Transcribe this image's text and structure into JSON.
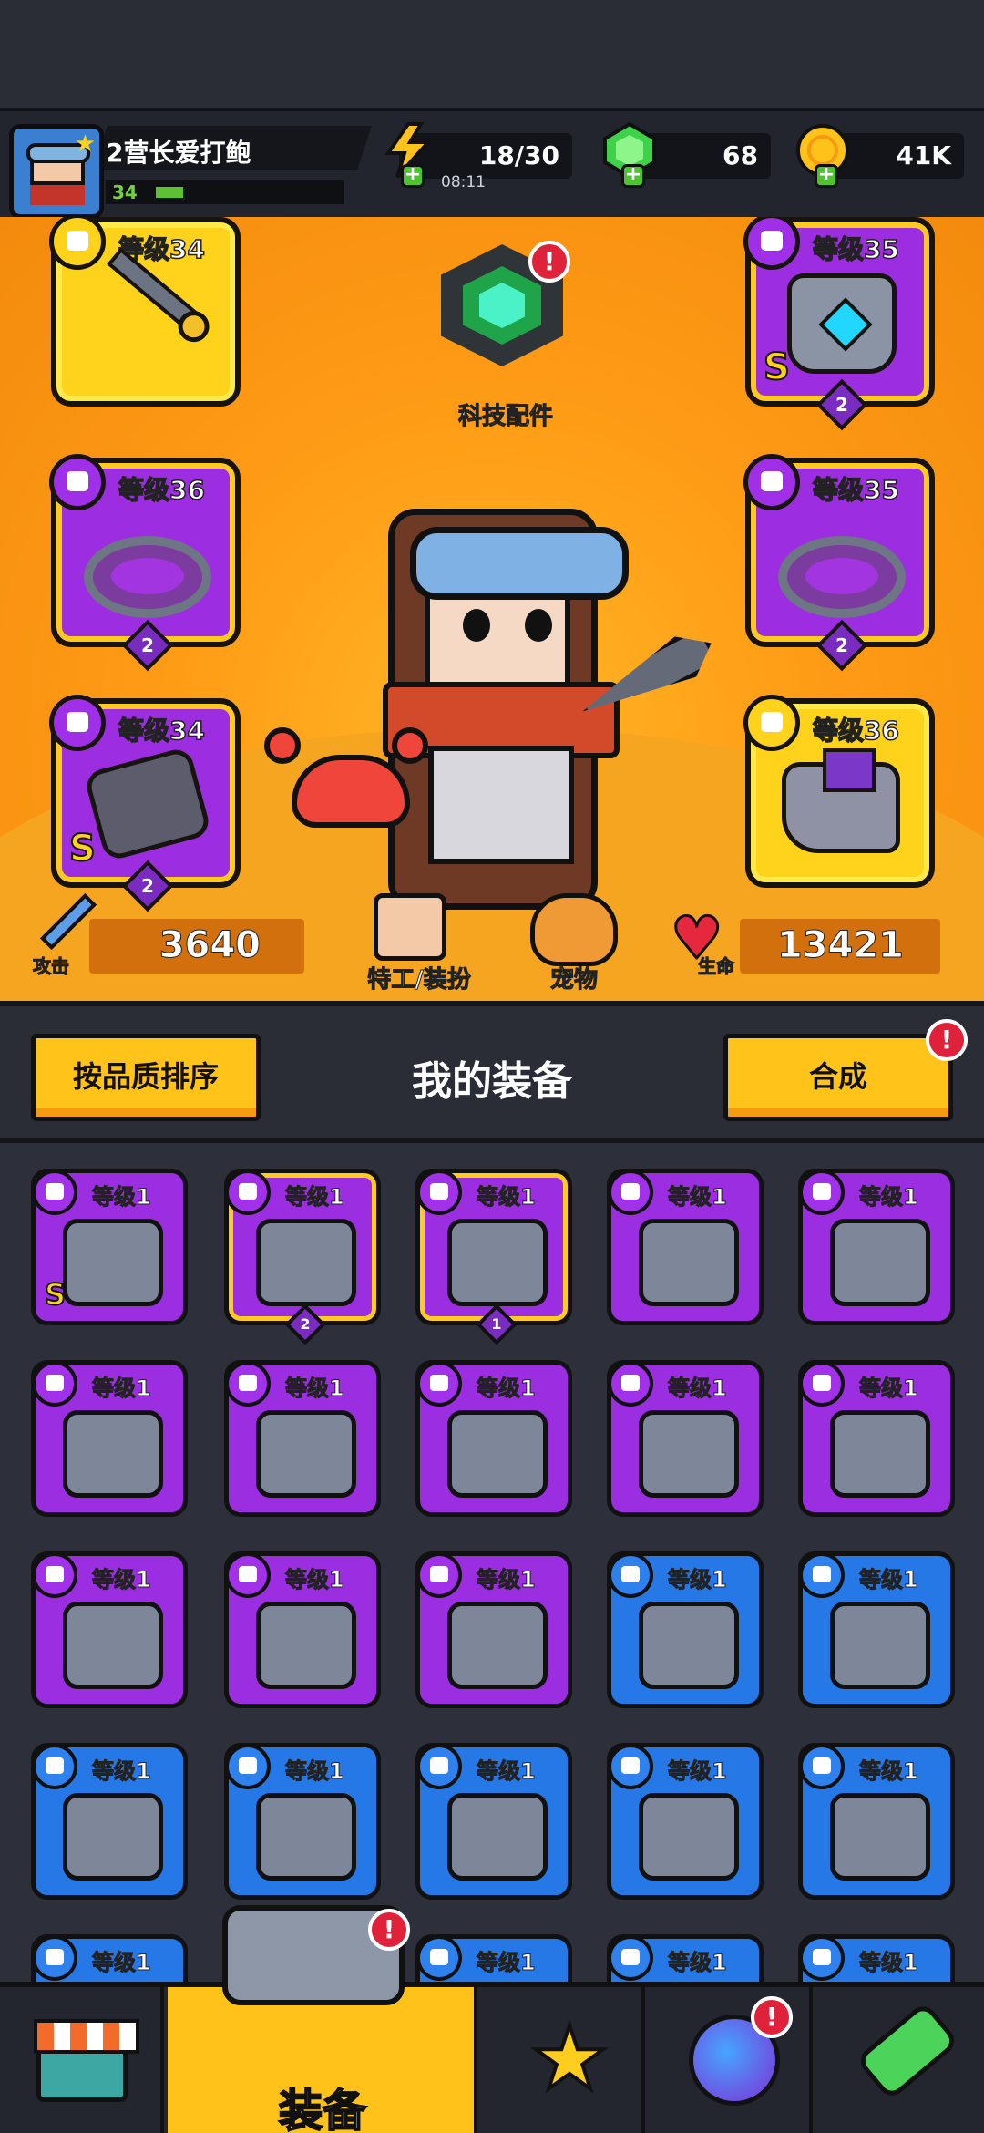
{
  "hud": {
    "player_name": "2营长爱打鲍",
    "player_level": "34",
    "energy": "18/30",
    "energy_timer": "08:11",
    "gems": "68",
    "coins": "41K"
  },
  "stage": {
    "tech_parts_label": "科技配件",
    "tech_parts_alert": "!",
    "slots": [
      {
        "level": "等级34",
        "quality": "gold",
        "icon": "kunai-icon"
      },
      {
        "level": "等级35",
        "quality": "purple",
        "stars": "2",
        "rank": "S",
        "icon": "armor-icon"
      },
      {
        "level": "等级36",
        "quality": "purple",
        "stars": "2",
        "icon": "spiked-ring-icon"
      },
      {
        "level": "等级35",
        "quality": "purple",
        "stars": "2",
        "icon": "belt-icon"
      },
      {
        "level": "等级34",
        "quality": "purple",
        "stars": "2",
        "rank": "S",
        "icon": "gauntlet-icon"
      },
      {
        "level": "等级36",
        "quality": "gold",
        "icon": "boot-icon"
      }
    ],
    "attack_label": "攻击",
    "attack_value": "3640",
    "hp_label": "生命",
    "hp_value": "13421",
    "agent_button": "特工/装扮",
    "pet_button": "宠物"
  },
  "section": {
    "sort_button": "按品质排序",
    "title": "我的装备",
    "merge_button": "合成",
    "merge_alert": "!"
  },
  "inventory": [
    {
      "level": "等级1",
      "color": "purple",
      "rank": "S",
      "icon": "dark-armor-icon"
    },
    {
      "level": "等级1",
      "color": "purple",
      "highlight": true,
      "stars": "2",
      "icon": "armor-icon"
    },
    {
      "level": "等级1",
      "color": "purple",
      "highlight": true,
      "stars": "1",
      "icon": "belt-icon"
    },
    {
      "level": "等级1",
      "color": "purple",
      "icon": "kunai-icon"
    },
    {
      "level": "等级1",
      "color": "purple",
      "icon": "armor-icon"
    },
    {
      "level": "等级1",
      "color": "purple",
      "icon": "rope-belt-icon"
    },
    {
      "level": "等级1",
      "color": "purple",
      "icon": "claw-glove-icon"
    },
    {
      "level": "等级1",
      "color": "purple",
      "icon": "gauntlet-icon"
    },
    {
      "level": "等级1",
      "color": "purple",
      "icon": "gauntlet-icon"
    },
    {
      "level": "等级1",
      "color": "purple",
      "icon": "gauntlet-icon"
    },
    {
      "level": "等级1",
      "color": "purple",
      "icon": "boot-icon"
    },
    {
      "level": "等级1",
      "color": "purple",
      "icon": "boot-icon"
    },
    {
      "level": "等级1",
      "color": "purple",
      "icon": "boot-icon"
    },
    {
      "level": "等级1",
      "color": "blue",
      "icon": "kunai-icon"
    },
    {
      "level": "等级1",
      "color": "blue",
      "icon": "vest-icon"
    },
    {
      "level": "等级1",
      "color": "blue",
      "icon": "vest-icon"
    },
    {
      "level": "等级1",
      "color": "blue",
      "icon": "armor-icon"
    },
    {
      "level": "等级1",
      "color": "blue",
      "icon": "armor-icon"
    },
    {
      "level": "等级1",
      "color": "blue",
      "icon": "bone-necklace-icon"
    },
    {
      "level": "等级1",
      "color": "blue",
      "icon": "gem-necklace-icon"
    },
    {
      "level": "等级1",
      "color": "blue",
      "icon": "necklace-icon"
    },
    {
      "level": "等级1",
      "color": "blue",
      "icon": "necklace-icon"
    },
    {
      "level": "等级1",
      "color": "blue",
      "icon": "necklace-icon"
    },
    {
      "level": "等级1",
      "color": "blue",
      "icon": "necklace-icon"
    },
    {
      "level": "等级1",
      "color": "blue",
      "icon": "belt-icon"
    }
  ],
  "nav": {
    "equipment_label": "装备",
    "equipment_alert": "!",
    "planet_alert": "!"
  }
}
